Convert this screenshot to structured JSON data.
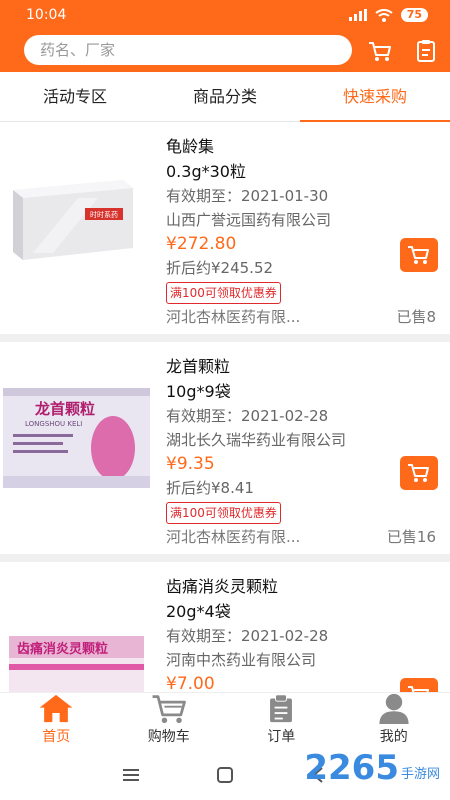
{
  "status": {
    "time": "10:04",
    "battery": "75"
  },
  "header": {
    "search_placeholder": "药名、厂家"
  },
  "tabs": [
    {
      "label": "活动专区"
    },
    {
      "label": "商品分类"
    },
    {
      "label": "快速采购"
    }
  ],
  "products": [
    {
      "name": "龟龄集",
      "spec": "0.3g*30粒",
      "expiry": "有效期至：2021-01-30",
      "manufacturer": "山西广誉远国药有限公司",
      "price": "¥272.80",
      "discount": "折后约¥245.52",
      "coupon": "满100可领取优惠券",
      "seller": "河北杏林医药有限...",
      "sold": "已售8",
      "box_text": "时时系药"
    },
    {
      "name": "龙首颗粒",
      "spec": "10g*9袋",
      "expiry": "有效期至：2021-02-28",
      "manufacturer": "湖北长久瑞华药业有限公司",
      "price": "¥9.35",
      "discount": "折后约¥8.41",
      "coupon": "满100可领取优惠券",
      "seller": "河北杏林医药有限...",
      "sold": "已售16",
      "box_text": "龙首颗粒",
      "box_sub": "LONGSHOU KELI"
    },
    {
      "name": "齿痛消炎灵颗粒",
      "spec": "20g*4袋",
      "expiry": "有效期至：2021-02-28",
      "manufacturer": "河南中杰药业有限公司",
      "price": "¥7.00",
      "box_text": "齿痛消炎灵颗粒"
    }
  ],
  "bottom_nav": [
    {
      "label": "首页"
    },
    {
      "label": "购物车"
    },
    {
      "label": "订单"
    },
    {
      "label": "我的"
    }
  ],
  "watermark": {
    "number": "2265",
    "text": "手游网"
  },
  "colors": {
    "accent": "#ff6a1a",
    "coupon": "#e0292c"
  }
}
